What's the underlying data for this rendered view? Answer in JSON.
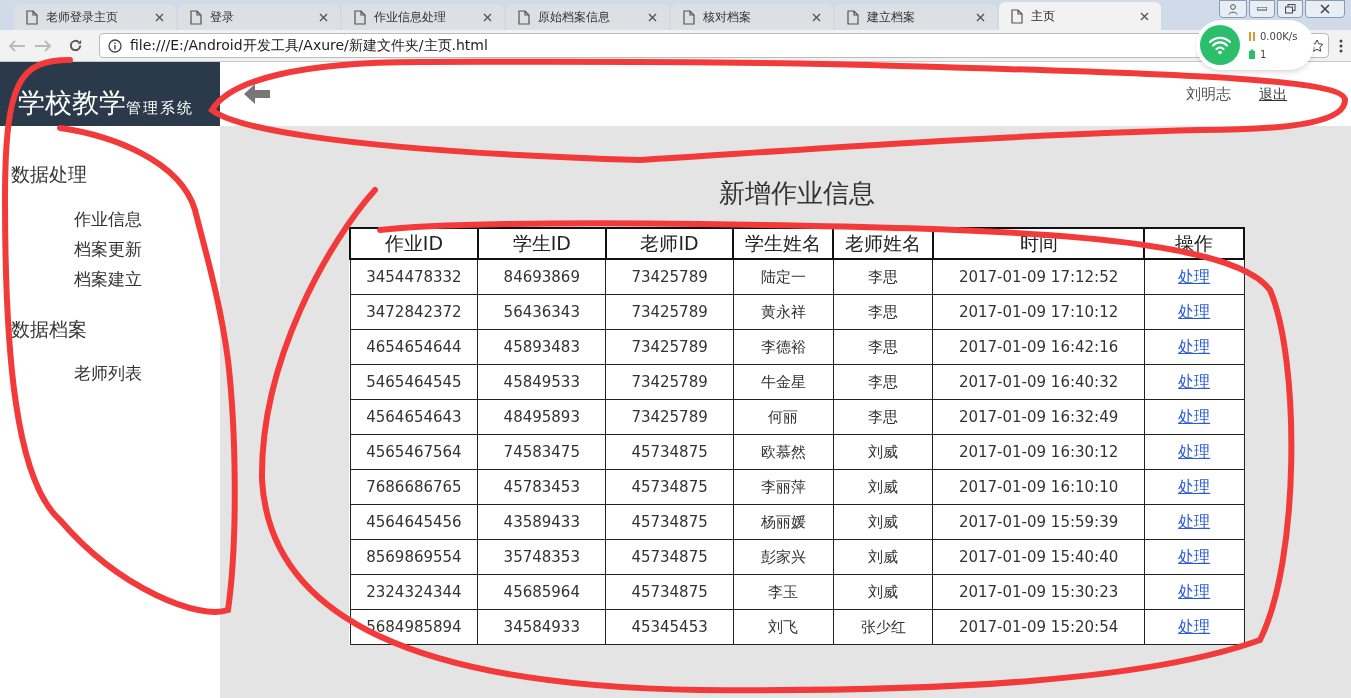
{
  "tabs": [
    {
      "label": "老师登录主页",
      "selected": false
    },
    {
      "label": "登录",
      "selected": false
    },
    {
      "label": "作业信息处理",
      "selected": false
    },
    {
      "label": "原始档案信息",
      "selected": false
    },
    {
      "label": "核对档案",
      "selected": false
    },
    {
      "label": "建立档案",
      "selected": false
    },
    {
      "label": "主页",
      "selected": true
    }
  ],
  "address": "file:///E:/Android开发工具/Axure/新建文件夹/主页.html",
  "network_widget": {
    "speed": "0.00K/s",
    "count": "1"
  },
  "logo": {
    "title": "学校教学",
    "subtitle": "管理系统"
  },
  "header": {
    "user": "刘明志",
    "logout": "退出"
  },
  "sidebar": [
    {
      "title": "数据处理",
      "items": [
        "作业信息",
        "档案更新",
        "档案建立"
      ]
    },
    {
      "title": "数据档案",
      "items": [
        "老师列表"
      ]
    }
  ],
  "page_title": "新增作业信息",
  "table": {
    "columns": [
      "作业ID",
      "学生ID",
      "老师ID",
      "学生姓名",
      "老师姓名",
      "时间",
      "操作"
    ],
    "rows": [
      [
        "3454478332",
        "84693869",
        "73425789",
        "陆定一",
        "李思",
        "2017-01-09 17:12:52",
        "处理"
      ],
      [
        "3472842372",
        "56436343",
        "73425789",
        "黄永祥",
        "李思",
        "2017-01-09 17:10:12",
        "处理"
      ],
      [
        "4654654644",
        "45893483",
        "73425789",
        "李德裕",
        "李思",
        "2017-01-09 16:42:16",
        "处理"
      ],
      [
        "5465464545",
        "45849533",
        "73425789",
        "牛金星",
        "李思",
        "2017-01-09 16:40:32",
        "处理"
      ],
      [
        "4564654643",
        "48495893",
        "73425789",
        "何丽",
        "李思",
        "2017-01-09 16:32:49",
        "处理"
      ],
      [
        "4565467564",
        "74583475",
        "45734875",
        "欧慕然",
        "刘威",
        "2017-01-09 16:30:12",
        "处理"
      ],
      [
        "7686686765",
        "45783453",
        "45734875",
        "李丽萍",
        "刘威",
        "2017-01-09 16:10:10",
        "处理"
      ],
      [
        "4564645456",
        "43589433",
        "45734875",
        "杨丽媛",
        "刘威",
        "2017-01-09 15:59:39",
        "处理"
      ],
      [
        "8569869554",
        "35748353",
        "45734875",
        "彭家兴",
        "刘威",
        "2017-01-09 15:40:40",
        "处理"
      ],
      [
        "2324324344",
        "45685964",
        "45734875",
        "李玉",
        "刘威",
        "2017-01-09 15:30:23",
        "处理"
      ],
      [
        "5684985894",
        "34584933",
        "45345453",
        "刘飞",
        "张少红",
        "2017-01-09 15:20:54",
        "处理"
      ]
    ]
  }
}
